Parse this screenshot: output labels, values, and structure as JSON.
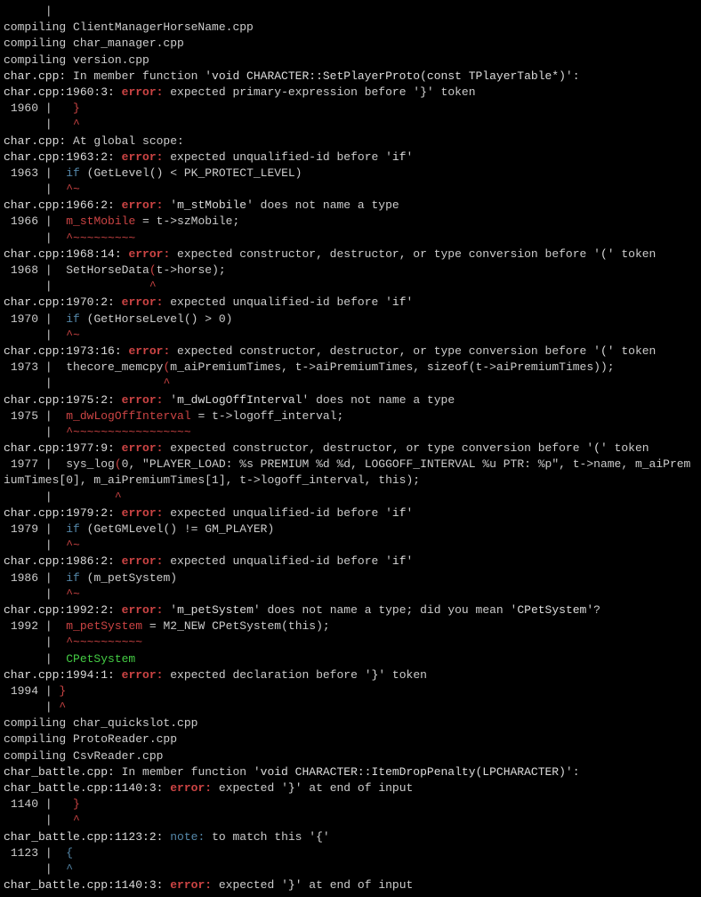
{
  "lines": [
    {
      "segs": [
        {
          "t": "      |         "
        }
      ]
    },
    {
      "segs": [
        {
          "t": "compiling ClientManagerHorseName.cpp"
        }
      ]
    },
    {
      "segs": [
        {
          "t": "compiling char_manager.cpp"
        }
      ]
    },
    {
      "segs": [
        {
          "t": "compiling version.cpp"
        }
      ]
    },
    {
      "segs": [
        {
          "cls": "white",
          "t": "char.cpp:"
        },
        {
          "t": " In member function '"
        },
        {
          "cls": "white",
          "t": "void CHARACTER::SetPlayerProto(const TPlayerTable*)"
        },
        {
          "t": "':"
        }
      ]
    },
    {
      "segs": [
        {
          "cls": "white",
          "t": "char.cpp:1960:3:"
        },
        {
          "t": " "
        },
        {
          "cls": "err",
          "t": "error:"
        },
        {
          "t": " expected primary-expression before '"
        },
        {
          "cls": "white",
          "t": "}"
        },
        {
          "t": "' token"
        }
      ]
    },
    {
      "segs": [
        {
          "t": " 1960 |   "
        },
        {
          "cls": "red",
          "t": "}"
        }
      ]
    },
    {
      "segs": [
        {
          "t": "      |   "
        },
        {
          "cls": "red",
          "t": "^"
        }
      ]
    },
    {
      "segs": [
        {
          "cls": "white",
          "t": "char.cpp:"
        },
        {
          "t": " At global scope:"
        }
      ]
    },
    {
      "segs": [
        {
          "cls": "white",
          "t": "char.cpp:1963:2:"
        },
        {
          "t": " "
        },
        {
          "cls": "err",
          "t": "error:"
        },
        {
          "t": " expected unqualified-id before '"
        },
        {
          "cls": "white",
          "t": "if"
        },
        {
          "t": "'"
        }
      ]
    },
    {
      "segs": [
        {
          "t": " 1963 |  "
        },
        {
          "cls": "cyan",
          "t": "if"
        },
        {
          "t": " (GetLevel() < PK_PROTECT_LEVEL)"
        }
      ]
    },
    {
      "segs": [
        {
          "t": "      |  "
        },
        {
          "cls": "red",
          "t": "^~"
        }
      ]
    },
    {
      "segs": [
        {
          "cls": "white",
          "t": "char.cpp:1966:2:"
        },
        {
          "t": " "
        },
        {
          "cls": "err",
          "t": "error:"
        },
        {
          "t": " '"
        },
        {
          "cls": "white",
          "t": "m_stMobile"
        },
        {
          "t": "' does not name a type"
        }
      ]
    },
    {
      "segs": [
        {
          "t": " 1966 |  "
        },
        {
          "cls": "red",
          "t": "m_stMobile"
        },
        {
          "t": " = t->szMobile;"
        }
      ]
    },
    {
      "segs": [
        {
          "t": "      |  "
        },
        {
          "cls": "red",
          "t": "^~~~~~~~~~"
        }
      ]
    },
    {
      "segs": [
        {
          "cls": "white",
          "t": "char.cpp:1968:14:"
        },
        {
          "t": " "
        },
        {
          "cls": "err",
          "t": "error:"
        },
        {
          "t": " expected constructor, destructor, or type conversion before '"
        },
        {
          "cls": "white",
          "t": "("
        },
        {
          "t": "' token"
        }
      ]
    },
    {
      "segs": [
        {
          "t": " 1968 |  SetHorseData"
        },
        {
          "cls": "red",
          "t": "("
        },
        {
          "t": "t->horse);"
        }
      ]
    },
    {
      "segs": [
        {
          "t": "      |              "
        },
        {
          "cls": "red",
          "t": "^"
        }
      ]
    },
    {
      "segs": [
        {
          "cls": "white",
          "t": "char.cpp:1970:2:"
        },
        {
          "t": " "
        },
        {
          "cls": "err",
          "t": "error:"
        },
        {
          "t": " expected unqualified-id before '"
        },
        {
          "cls": "white",
          "t": "if"
        },
        {
          "t": "'"
        }
      ]
    },
    {
      "segs": [
        {
          "t": " 1970 |  "
        },
        {
          "cls": "cyan",
          "t": "if"
        },
        {
          "t": " (GetHorseLevel() > 0)"
        }
      ]
    },
    {
      "segs": [
        {
          "t": "      |  "
        },
        {
          "cls": "red",
          "t": "^~"
        }
      ]
    },
    {
      "segs": [
        {
          "cls": "white",
          "t": "char.cpp:1973:16:"
        },
        {
          "t": " "
        },
        {
          "cls": "err",
          "t": "error:"
        },
        {
          "t": " expected constructor, destructor, or type conversion before '"
        },
        {
          "cls": "white",
          "t": "("
        },
        {
          "t": "' token"
        }
      ]
    },
    {
      "segs": [
        {
          "t": " 1973 |  thecore_memcpy"
        },
        {
          "cls": "red",
          "t": "("
        },
        {
          "t": "m_aiPremiumTimes, t->aiPremiumTimes, sizeof(t->aiPremiumTimes));"
        }
      ]
    },
    {
      "segs": [
        {
          "t": "      |                "
        },
        {
          "cls": "red",
          "t": "^"
        }
      ]
    },
    {
      "segs": [
        {
          "cls": "white",
          "t": "char.cpp:1975:2:"
        },
        {
          "t": " "
        },
        {
          "cls": "err",
          "t": "error:"
        },
        {
          "t": " '"
        },
        {
          "cls": "white",
          "t": "m_dwLogOffInterval"
        },
        {
          "t": "' does not name a type"
        }
      ]
    },
    {
      "segs": [
        {
          "t": " 1975 |  "
        },
        {
          "cls": "red",
          "t": "m_dwLogOffInterval"
        },
        {
          "t": " = t->logoff_interval;"
        }
      ]
    },
    {
      "segs": [
        {
          "t": "      |  "
        },
        {
          "cls": "red",
          "t": "^~~~~~~~~~~~~~~~~~"
        }
      ]
    },
    {
      "segs": [
        {
          "cls": "white",
          "t": "char.cpp:1977:9:"
        },
        {
          "t": " "
        },
        {
          "cls": "err",
          "t": "error:"
        },
        {
          "t": " expected constructor, destructor, or type conversion before '"
        },
        {
          "cls": "white",
          "t": "("
        },
        {
          "t": "' token"
        }
      ]
    },
    {
      "segs": [
        {
          "t": " 1977 |  sys_log"
        },
        {
          "cls": "red",
          "t": "("
        },
        {
          "t": "0, \"PLAYER_LOAD: %s PREMIUM %d %d, LOGGOFF_INTERVAL %u PTR: %p\", t->name, m_aiPremiumTimes[0], m_aiPremiumTimes[1], t->logoff_interval, this);"
        }
      ]
    },
    {
      "segs": [
        {
          "t": "      |         "
        },
        {
          "cls": "red",
          "t": "^"
        }
      ]
    },
    {
      "segs": [
        {
          "cls": "white",
          "t": "char.cpp:1979:2:"
        },
        {
          "t": " "
        },
        {
          "cls": "err",
          "t": "error:"
        },
        {
          "t": " expected unqualified-id before '"
        },
        {
          "cls": "white",
          "t": "if"
        },
        {
          "t": "'"
        }
      ]
    },
    {
      "segs": [
        {
          "t": " 1979 |  "
        },
        {
          "cls": "cyan",
          "t": "if"
        },
        {
          "t": " (GetGMLevel() != GM_PLAYER)"
        }
      ]
    },
    {
      "segs": [
        {
          "t": "      |  "
        },
        {
          "cls": "red",
          "t": "^~"
        }
      ]
    },
    {
      "segs": [
        {
          "cls": "white",
          "t": "char.cpp:1986:2:"
        },
        {
          "t": " "
        },
        {
          "cls": "err",
          "t": "error:"
        },
        {
          "t": " expected unqualified-id before '"
        },
        {
          "cls": "white",
          "t": "if"
        },
        {
          "t": "'"
        }
      ]
    },
    {
      "segs": [
        {
          "t": " 1986 |  "
        },
        {
          "cls": "cyan",
          "t": "if"
        },
        {
          "t": " (m_petSystem)"
        }
      ]
    },
    {
      "segs": [
        {
          "t": "      |  "
        },
        {
          "cls": "red",
          "t": "^~"
        }
      ]
    },
    {
      "segs": [
        {
          "cls": "white",
          "t": "char.cpp:1992:2:"
        },
        {
          "t": " "
        },
        {
          "cls": "err",
          "t": "error:"
        },
        {
          "t": " '"
        },
        {
          "cls": "white",
          "t": "m_petSystem"
        },
        {
          "t": "' does not name a type; did you mean '"
        },
        {
          "cls": "white",
          "t": "CPetSystem"
        },
        {
          "t": "'?"
        }
      ]
    },
    {
      "segs": [
        {
          "t": " 1992 |  "
        },
        {
          "cls": "red",
          "t": "m_petSystem"
        },
        {
          "t": " = M2_NEW CPetSystem(this);"
        }
      ]
    },
    {
      "segs": [
        {
          "t": "      |  "
        },
        {
          "cls": "red",
          "t": "^~~~~~~~~~~"
        }
      ]
    },
    {
      "segs": [
        {
          "t": "      |  "
        },
        {
          "cls": "green",
          "t": "CPetSystem"
        }
      ]
    },
    {
      "segs": [
        {
          "cls": "white",
          "t": "char.cpp:1994:1:"
        },
        {
          "t": " "
        },
        {
          "cls": "err",
          "t": "error:"
        },
        {
          "t": " expected declaration before '"
        },
        {
          "cls": "white",
          "t": "}"
        },
        {
          "t": "' token"
        }
      ]
    },
    {
      "segs": [
        {
          "t": " 1994 | "
        },
        {
          "cls": "red",
          "t": "}"
        }
      ]
    },
    {
      "segs": [
        {
          "t": "      | "
        },
        {
          "cls": "red",
          "t": "^"
        }
      ]
    },
    {
      "segs": [
        {
          "t": "compiling char_quickslot.cpp"
        }
      ]
    },
    {
      "segs": [
        {
          "t": "compiling ProtoReader.cpp"
        }
      ]
    },
    {
      "segs": [
        {
          "t": "compiling CsvReader.cpp"
        }
      ]
    },
    {
      "segs": [
        {
          "cls": "white",
          "t": "char_battle.cpp:"
        },
        {
          "t": " In member function '"
        },
        {
          "cls": "white",
          "t": "void CHARACTER::ItemDropPenalty(LPCHARACTER)"
        },
        {
          "t": "':"
        }
      ]
    },
    {
      "segs": [
        {
          "cls": "white",
          "t": "char_battle.cpp:1140:3:"
        },
        {
          "t": " "
        },
        {
          "cls": "err",
          "t": "error:"
        },
        {
          "t": " expected '"
        },
        {
          "cls": "white",
          "t": "}"
        },
        {
          "t": "' at end of input"
        }
      ]
    },
    {
      "segs": [
        {
          "t": " 1140 |   "
        },
        {
          "cls": "red",
          "t": "}"
        }
      ]
    },
    {
      "segs": [
        {
          "t": "      |   "
        },
        {
          "cls": "red",
          "t": "^"
        }
      ]
    },
    {
      "segs": [
        {
          "cls": "white",
          "t": "char_battle.cpp:1123:2:"
        },
        {
          "t": " "
        },
        {
          "cls": "cyan",
          "t": "note:"
        },
        {
          "t": " to match this '"
        },
        {
          "cls": "white",
          "t": "{"
        },
        {
          "t": "'"
        }
      ]
    },
    {
      "segs": [
        {
          "t": " 1123 |  "
        },
        {
          "cls": "cyan",
          "t": "{"
        }
      ]
    },
    {
      "segs": [
        {
          "t": "      |  "
        },
        {
          "cls": "cyan",
          "t": "^"
        }
      ]
    },
    {
      "segs": [
        {
          "cls": "white",
          "t": "char_battle.cpp:1140:3:"
        },
        {
          "t": " "
        },
        {
          "cls": "err",
          "t": "error:"
        },
        {
          "t": " expected '"
        },
        {
          "cls": "white",
          "t": "}"
        },
        {
          "t": "' at end of input"
        }
      ]
    }
  ]
}
